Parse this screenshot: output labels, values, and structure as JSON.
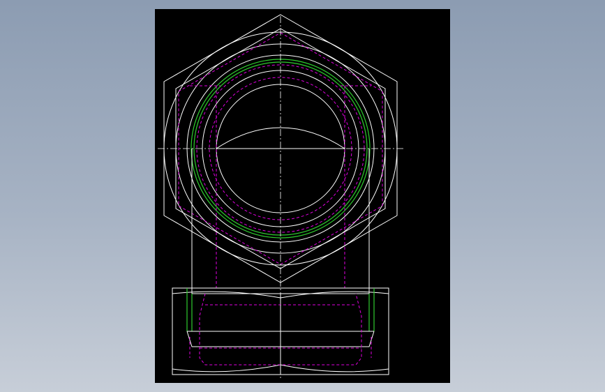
{
  "app": {
    "view": "cad-drawing-viewport",
    "background_color": "#000000",
    "frame_color": "#8c9cb2"
  },
  "drawing": {
    "subject": "hex-nut-fitting-two-views",
    "line_colors": {
      "visible_edge": "#ffffff",
      "hidden_edge": "#e000e0",
      "thread_line": "#2ecc2e",
      "centerline": "#ffffff"
    }
  }
}
